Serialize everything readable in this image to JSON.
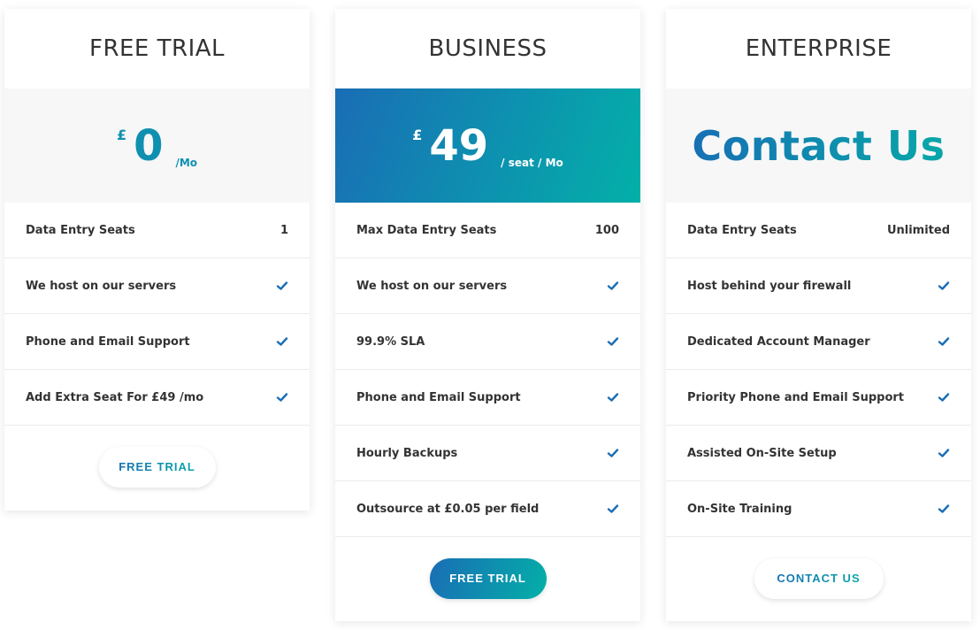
{
  "plans": [
    {
      "title": "FREE TRIAL",
      "currency": "£",
      "amount": "0",
      "period": "/Mo",
      "features": [
        {
          "label": "Data Entry Seats",
          "value": "1"
        },
        {
          "label": "We host on our servers",
          "icon": "check-icon"
        },
        {
          "label": "Phone and Email Support",
          "icon": "check-icon"
        },
        {
          "label": "Add Extra Seat For £49 /mo",
          "icon": "check-icon"
        }
      ],
      "button": "FREE TRIAL"
    },
    {
      "title": "BUSINESS",
      "currency": "£",
      "amount": "49",
      "period": "/ seat / Mo",
      "features": [
        {
          "label": "Max Data Entry Seats",
          "value": "100"
        },
        {
          "label": "We host on our servers",
          "icon": "check-icon"
        },
        {
          "label": "99.9% SLA",
          "icon": "check-icon"
        },
        {
          "label": "Phone and Email Support",
          "icon": "check-icon"
        },
        {
          "label": "Hourly Backups",
          "icon": "check-icon"
        },
        {
          "label": "Outsource at £0.05 per field",
          "icon": "check-icon"
        }
      ],
      "button": "FREE TRIAL"
    },
    {
      "title": "ENTERPRISE",
      "price_text": "Contact Us",
      "features": [
        {
          "label": "Data Entry Seats",
          "value": "Unlimited"
        },
        {
          "label": "Host behind your firewall",
          "icon": "check-icon"
        },
        {
          "label": "Dedicated Account Manager",
          "icon": "check-icon"
        },
        {
          "label": "Priority Phone and Email Support",
          "icon": "check-icon"
        },
        {
          "label": "Assisted On-Site Setup",
          "icon": "check-icon"
        },
        {
          "label": "On-Site Training",
          "icon": "check-icon"
        }
      ],
      "button": "CONTACT US"
    }
  ],
  "colors": {
    "accent_start": "#1a6db5",
    "accent_end": "#03b0a8",
    "check": "#1a6db5"
  }
}
